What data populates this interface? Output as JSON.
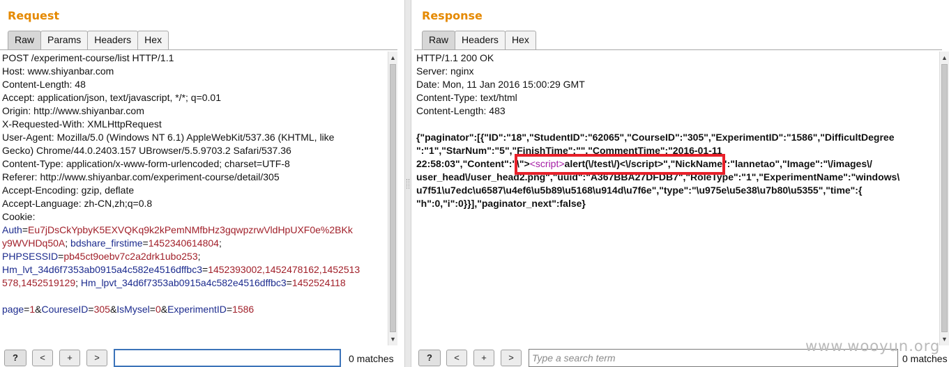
{
  "request": {
    "title": "Request",
    "tabs": [
      "Raw",
      "Params",
      "Headers",
      "Hex"
    ],
    "lines": [
      "POST /experiment-course/list HTTP/1.1",
      "Host: www.shiyanbar.com",
      "Content-Length: 48",
      "Accept: application/json, text/javascript, */*; q=0.01",
      "Origin: http://www.shiyanbar.com",
      "X-Requested-With: XMLHttpRequest",
      "User-Agent: Mozilla/5.0 (Windows NT 6.1) AppleWebKit/537.36 (KHTML, like",
      "Gecko) Chrome/44.0.2403.157 UBrowser/5.5.9703.2 Safari/537.36",
      "Content-Type: application/x-www-form-urlencoded; charset=UTF-8",
      "Referer: http://www.shiyanbar.com/experiment-course/detail/305",
      "Accept-Encoding: gzip, deflate",
      "Accept-Language: zh-CN,zh;q=0.8",
      "Cookie:"
    ],
    "cookie_lines": [
      [
        {
          "k": "Auth",
          "v": "Eu7jDsCkYpbyK5EXVQKq9k2kPemNMfbHz3gqwpzrwVldHpUXF0e%2BKk"
        }
      ],
      [
        {
          "k": "",
          "v": "y9WVHDq50A"
        },
        {
          "t": "; "
        },
        {
          "k": "bdshare_firstime",
          "v": "1452340614804"
        },
        {
          "t": ";"
        }
      ],
      [
        {
          "k": "PHPSESSID",
          "v": "pb45ct9oebv7c2a2drk1ubo253"
        },
        {
          "t": ";"
        }
      ],
      [
        {
          "k": "Hm_lvt_34d6f7353ab0915a4c582e4516dffbc3",
          "v": "1452393002,1452478162,1452513"
        }
      ],
      [
        {
          "k": "",
          "v": "578,1452519129"
        },
        {
          "t": "; "
        },
        {
          "k": "Hm_lpvt_34d6f7353ab0915a4c582e4516dffbc3",
          "v": "1452524118"
        }
      ]
    ],
    "body_params": [
      {
        "k": "page",
        "v": "1"
      },
      {
        "k": "CoureseID",
        "v": "305"
      },
      {
        "k": "IsMysel",
        "v": "0"
      },
      {
        "k": "ExperimentID",
        "v": "1586"
      }
    ],
    "search": {
      "value": "",
      "placeholder": "",
      "matches": "0 matches"
    }
  },
  "response": {
    "title": "Response",
    "tabs": [
      "Raw",
      "Headers",
      "Hex"
    ],
    "lines": [
      "HTTP/1.1 200 OK",
      "Server: nginx",
      "Date: Mon, 11 Jan 2016 15:00:29 GMT",
      "Content-Type: text/html",
      "Content-Length: 483"
    ],
    "json_lines": [
      [
        {
          "t": "{\"paginator\":[{\"ID\":\"18\",\"StudentID\":\"62065\",\"CourseID\":\"305\",\"ExperimentID\":\"1586\",\"DifficultDegree"
        }
      ],
      [
        {
          "t": "\":\"1\",\"StarNum\":\"5\",\"FinishTime\":\"\",\"CommentTime\":\"2016-01-11"
        }
      ],
      [
        {
          "t": "22:58:03\",\"Content\":\"\\\">"
        },
        {
          "tag": "<script>"
        },
        {
          "t": "alert(\\/test\\/)<\\/script>\",\"NickName\":\"lannetao\",\"Image\":\"\\/images\\/"
        }
      ],
      [
        {
          "t": "user_head\\/user_head2.png\",\"uuid\":\"A367BBA27DFDB7\",\"RoleType\":\"1\",\"ExperimentName\":\"windows\\"
        }
      ],
      [
        {
          "t": "u7f51\\u7edc\\u6587\\u4ef6\\u5b89\\u5168\\u914d\\u7f6e\",\"type\":\"\\u975e\\u5e38\\u7b80\\u5355\",\"time\":{"
        }
      ],
      [
        {
          "t": "\"h\":0,\"i\":0}}],\"paginator_next\":false}"
        }
      ]
    ],
    "search": {
      "value": "",
      "placeholder": "Type a search term",
      "matches": "0 matches"
    }
  },
  "search_buttons": {
    "help": "?",
    "prev": "<",
    "add": "+",
    "next": ">"
  },
  "watermark": "www.wooyun.org"
}
